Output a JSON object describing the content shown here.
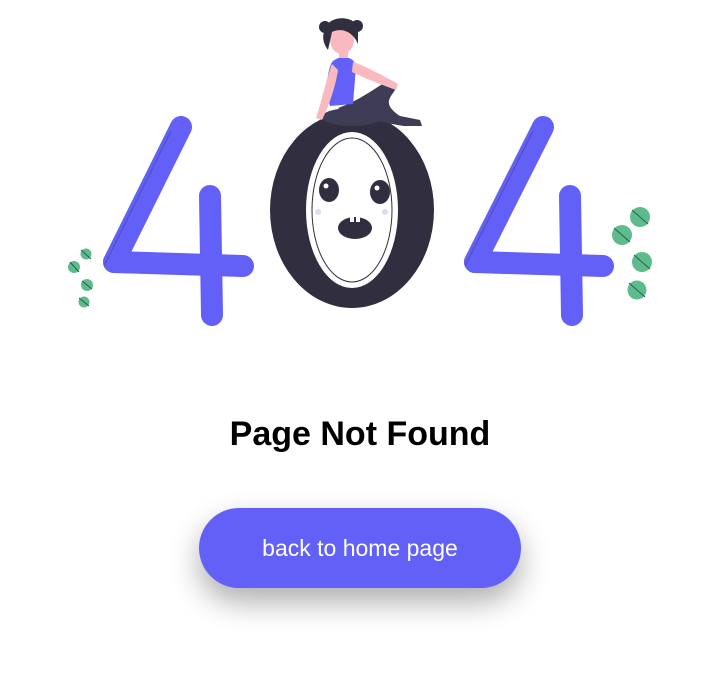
{
  "colors": {
    "accent": "#6360f7",
    "dark": "#302e3f",
    "leaf": "#5dbb8e",
    "skin": "#f8b9bf",
    "button_text": "#ffffff"
  },
  "page": {
    "title": "Page Not Found"
  },
  "actions": {
    "home_label": "back to home page"
  }
}
